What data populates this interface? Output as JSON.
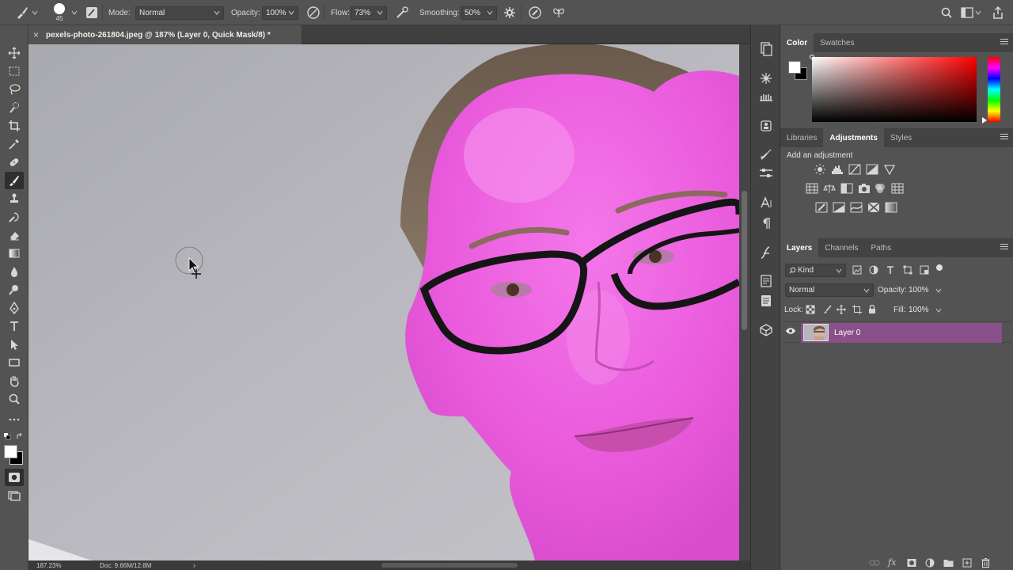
{
  "options_bar": {
    "brush_size": "45",
    "mode_label": "Mode:",
    "mode_value": "Normal",
    "opacity_label": "Opacity:",
    "opacity_value": "100%",
    "flow_label": "Flow:",
    "flow_value": "73%",
    "smoothing_label": "Smoothing:",
    "smoothing_value": "50%"
  },
  "document": {
    "tab_title": "pexels-photo-261804.jpeg @ 187% (Layer 0, Quick Mask/8) *",
    "close_symbol": "×",
    "status_zoom": "187.23%",
    "status_doc": "Doc: 9.66M/12.8M",
    "status_arrow": "›"
  },
  "color_panel": {
    "tabs": [
      "Color",
      "Swatches"
    ],
    "active_tab": "Color"
  },
  "adjustments_panel": {
    "tabs": [
      "Libraries",
      "Adjustments",
      "Styles"
    ],
    "active_tab": "Adjustments",
    "heading": "Add an adjustment"
  },
  "layers_panel": {
    "tabs": [
      "Layers",
      "Channels",
      "Paths"
    ],
    "active_tab": "Layers",
    "filter_kind": "Kind",
    "blend_mode": "Normal",
    "opacity_label": "Opacity:",
    "opacity_value": "100%",
    "lock_label": "Lock:",
    "fill_label": "Fill:",
    "fill_value": "100%",
    "layers": [
      {
        "name": "Layer 0",
        "visible": true,
        "selected": true
      }
    ]
  },
  "colors": {
    "ui_bg": "#535353",
    "quick_mask_overlay": "#ee5fe2",
    "selected_layer": "#8a5089",
    "foreground": "#ffffff",
    "background": "#000000"
  }
}
